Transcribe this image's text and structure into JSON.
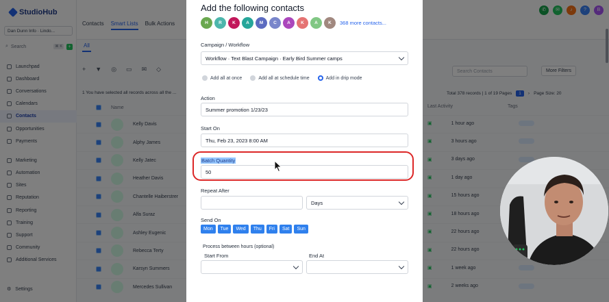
{
  "app": {
    "brand": "StudioHub",
    "account": "Dan Dunn Info · Lindo...",
    "search_placeholder": "Search",
    "search_shortcut": "⌘ K",
    "nav": [
      "Launchpad",
      "Dashboard",
      "Conversations",
      "Calendars",
      "Contacts",
      "Opportunities",
      "Payments"
    ],
    "nav2": [
      "Marketing",
      "Automation",
      "Sites",
      "Reputation",
      "Reporting",
      "Training",
      "Support",
      "Community",
      "Additional Services"
    ],
    "settings": "Settings",
    "tabs": [
      "Contacts",
      "Smart Lists",
      "Bulk Actions"
    ],
    "subtab": "All",
    "notice": "1 You have selected all records across all the ...",
    "search_contacts": "Search Contacts",
    "more_filters": "More Filters",
    "paging": "Total 378 records | 1 of 19 Pages",
    "page_current": "1",
    "page_size": "Page Size: 20",
    "col_name": "Name",
    "col_last_activity": "Last Activity",
    "col_tags": "Tags",
    "rows": [
      {
        "name": "Kelly Davis",
        "activity": "1 hour ago"
      },
      {
        "name": "Alphy James",
        "activity": "3 hours ago"
      },
      {
        "name": "Kelly Jatec",
        "activity": "3 days ago"
      },
      {
        "name": "Heather Davis",
        "activity": "1 day ago"
      },
      {
        "name": "Chantelle Haiberstrer",
        "activity": "15 hours ago"
      },
      {
        "name": "Alfa Suraz",
        "activity": "18 hours ago"
      },
      {
        "name": "Ashley Eugenic",
        "activity": "22 hours ago"
      },
      {
        "name": "Rebecca Terty",
        "activity": "22 hours ago"
      },
      {
        "name": "Karsyn Summers",
        "activity": "1 week ago"
      },
      {
        "name": "Mercedes Sullivan",
        "activity": "2 weeks ago"
      }
    ]
  },
  "modal": {
    "title": "Add the following contacts",
    "chips": [
      {
        "letter": "H",
        "color": "#6aa84f"
      },
      {
        "letter": "R",
        "color": "#4db6ac"
      },
      {
        "letter": "K",
        "color": "#c2185b"
      },
      {
        "letter": "A",
        "color": "#26a69a"
      },
      {
        "letter": "M",
        "color": "#5c6bc0"
      },
      {
        "letter": "C",
        "color": "#7986cb"
      },
      {
        "letter": "A",
        "color": "#ab47bc"
      },
      {
        "letter": "K",
        "color": "#e57373"
      },
      {
        "letter": "A",
        "color": "#81c784"
      },
      {
        "letter": "K",
        "color": "#a1887f"
      }
    ],
    "more_contacts": "368 more contacts...",
    "campaign_label": "Campaign / Workflow",
    "campaign_value": "Workflow · Text Blast Campaign · Early Bird Summer camps",
    "radio_options": [
      {
        "label": "Add all at once",
        "selected": false
      },
      {
        "label": "Add all at schedule time",
        "selected": false
      },
      {
        "label": "Add in drip mode",
        "selected": true
      }
    ],
    "action_label": "Action",
    "action_value": "Summer promotion 1/23/23",
    "start_label": "Start On",
    "start_value": "Thu, Feb 23, 2023 8:00 AM",
    "batch_label": "Batch Quantity",
    "batch_value": "50",
    "repeat_label": "Repeat After",
    "repeat_value": "",
    "repeat_unit": "Days",
    "send_on_label": "Send On",
    "days": [
      "Mon",
      "Tue",
      "Wed",
      "Thu",
      "Fri",
      "Sat",
      "Sun"
    ],
    "process_label": "Process between hours (optional)",
    "start_from_label": "Start From",
    "end_at_label": "End At"
  },
  "colors": {
    "accent": "#2563eb",
    "highlight_ring": "#dc2626",
    "day_button": "#2f80ed"
  }
}
